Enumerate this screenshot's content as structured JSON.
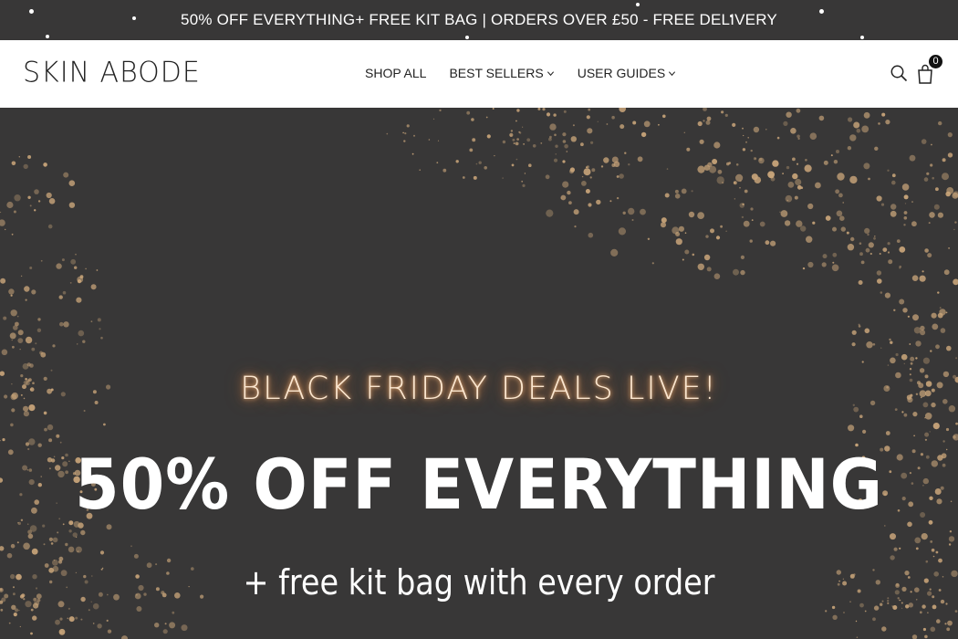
{
  "announcement": {
    "text": "50% OFF EVERYTHING+ FREE KIT BAG | ORDERS OVER £50 - FREE DELIVERY"
  },
  "header": {
    "logo": "SKIN ABODE",
    "nav": [
      {
        "label": "SHOP ALL",
        "dropdown": false
      },
      {
        "label": "BEST SELLERS",
        "dropdown": true
      },
      {
        "label": "USER GUIDES",
        "dropdown": true
      }
    ],
    "icons": [
      "search-icon",
      "shopping-bag-icon"
    ],
    "cart_count": "0"
  },
  "hero": {
    "neon_text": "BLACK FRIDAY DEALS LIVE!",
    "headline": "50% OFF  EVERYTHING",
    "subheadline": "+ free kit bag with every order"
  },
  "colors": {
    "background": "#383737",
    "header_bg": "#ffffff",
    "neon": "#fbe6cf",
    "glitter": "#c9a57a",
    "text": "#ffffff"
  }
}
